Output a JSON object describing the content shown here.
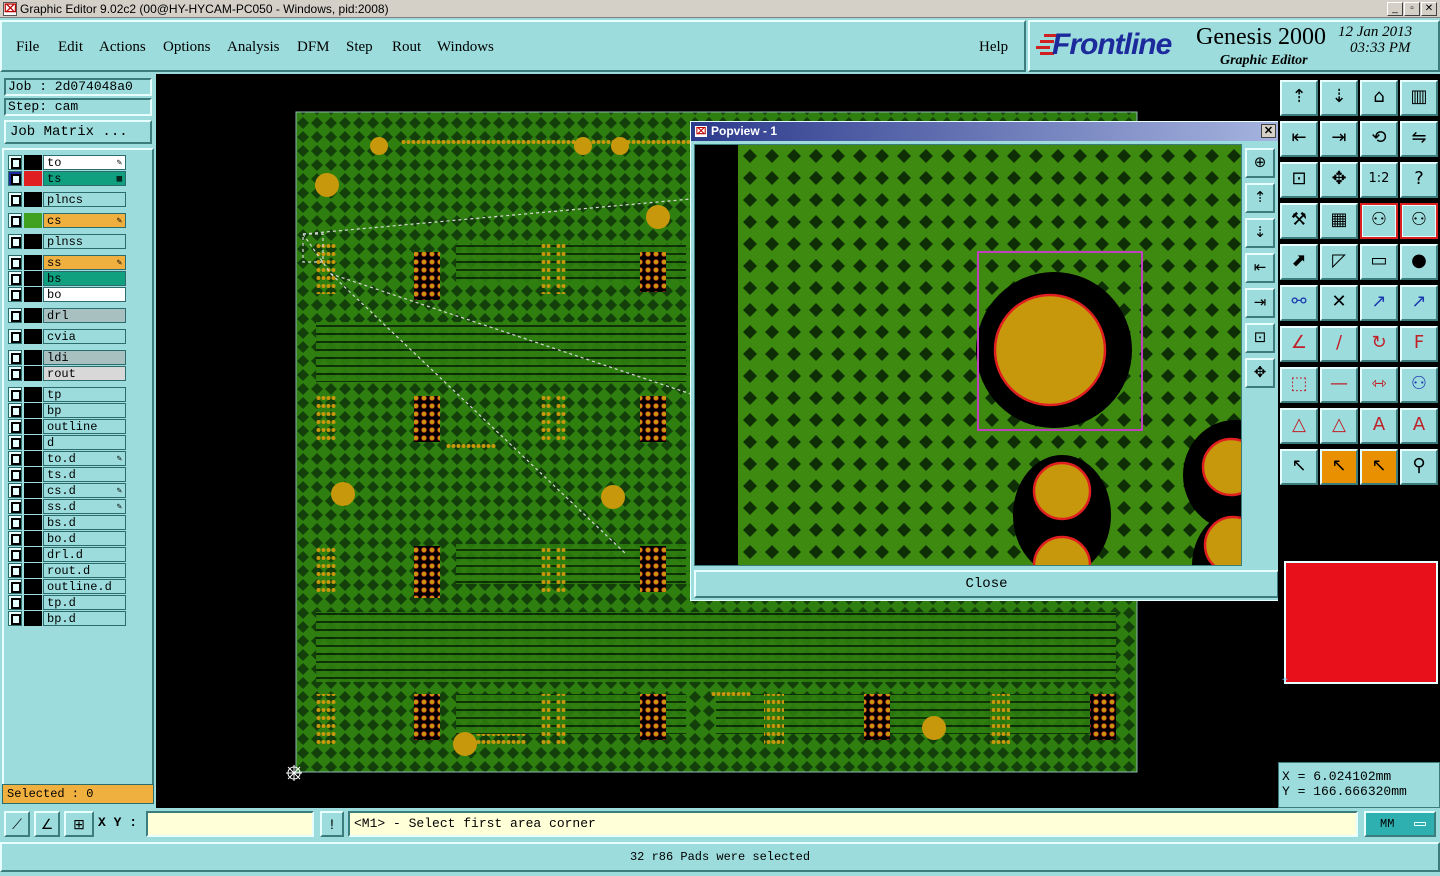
{
  "window": {
    "title": "Graphic Editor 9.02c2 (00@HY-HYCAM-PC050 - Windows, pid:2008)",
    "controls": {
      "minimize": "_",
      "maximize": "▫",
      "close": "✕"
    }
  },
  "menu": {
    "items": [
      "File",
      "Edit",
      "Actions",
      "Options",
      "Analysis",
      "DFM",
      "Step",
      "Rout",
      "Windows"
    ],
    "help": "Help"
  },
  "brand": {
    "logo": "Frontline",
    "product": "Genesis 2000",
    "subtitle": "Graphic Editor",
    "date": "12 Jan 2013",
    "time": "03:33 PM"
  },
  "job": {
    "job_label": "Job : 2d074048a0",
    "step_label": "Step: cam",
    "matrix_button": "Job Matrix ..."
  },
  "layers": [
    {
      "name": "to",
      "swatch": "#000000",
      "bg": "#ffffff",
      "flag": "✎"
    },
    {
      "name": "ts",
      "swatch": "#e02020",
      "bg": "#10a080",
      "flag": "▦",
      "work": true
    },
    {
      "name": "plncs",
      "swatch": "#000000",
      "bg": "#9cdcdc",
      "flag": ""
    },
    {
      "name": "cs",
      "swatch": "#40a020",
      "bg": "#f0b040",
      "flag": "✎"
    },
    {
      "name": "plnss",
      "swatch": "#000000",
      "bg": "#9cdcdc",
      "flag": ""
    },
    {
      "name": "ss",
      "swatch": "#000000",
      "bg": "#f0b040",
      "flag": "✎"
    },
    {
      "name": "bs",
      "swatch": "#000000",
      "bg": "#10a080",
      "flag": ""
    },
    {
      "name": "bo",
      "swatch": "#000000",
      "bg": "#ffffff",
      "flag": ""
    },
    {
      "name": "drl",
      "swatch": "#000000",
      "bg": "#a8c0c0",
      "flag": ""
    },
    {
      "name": "cvia",
      "swatch": "#000000",
      "bg": "#9cdcdc",
      "flag": ""
    },
    {
      "name": "ldi",
      "swatch": "#000000",
      "bg": "#a8c0c0",
      "flag": ""
    },
    {
      "name": "rout",
      "swatch": "#000000",
      "bg": "#d8d8d8",
      "flag": ""
    },
    {
      "name": "tp",
      "swatch": "#000000",
      "bg": "#9cdcdc",
      "flag": ""
    },
    {
      "name": "bp",
      "swatch": "#000000",
      "bg": "#9cdcdc",
      "flag": ""
    },
    {
      "name": "outline",
      "swatch": "#000000",
      "bg": "#9cdcdc",
      "flag": ""
    },
    {
      "name": "d",
      "swatch": "#000000",
      "bg": "#9cdcdc",
      "flag": ""
    },
    {
      "name": "to.d",
      "swatch": "#000000",
      "bg": "#9cdcdc",
      "flag": "✎"
    },
    {
      "name": "ts.d",
      "swatch": "#000000",
      "bg": "#9cdcdc",
      "flag": ""
    },
    {
      "name": "cs.d",
      "swatch": "#000000",
      "bg": "#9cdcdc",
      "flag": "✎"
    },
    {
      "name": "ss.d",
      "swatch": "#000000",
      "bg": "#9cdcdc",
      "flag": "✎"
    },
    {
      "name": "bs.d",
      "swatch": "#000000",
      "bg": "#9cdcdc",
      "flag": ""
    },
    {
      "name": "bo.d",
      "swatch": "#000000",
      "bg": "#9cdcdc",
      "flag": ""
    },
    {
      "name": "drl.d",
      "swatch": "#000000",
      "bg": "#9cdcdc",
      "flag": ""
    },
    {
      "name": "rout.d",
      "swatch": "#000000",
      "bg": "#9cdcdc",
      "flag": ""
    },
    {
      "name": "outline.d",
      "swatch": "#000000",
      "bg": "#9cdcdc",
      "flag": ""
    },
    {
      "name": "tp.d",
      "swatch": "#000000",
      "bg": "#9cdcdc",
      "flag": ""
    },
    {
      "name": "bp.d",
      "swatch": "#000000",
      "bg": "#9cdcdc",
      "flag": ""
    }
  ],
  "selected_label": "Selected : 0",
  "popview": {
    "title": "Popview - 1",
    "close_button": "Close"
  },
  "coords": {
    "x": "X  =   6.024102mm",
    "y": "Y  = 166.666320mm"
  },
  "command": {
    "xy_label": "X Y :",
    "xy_value": "",
    "prompt": "<M1> - Select first area corner",
    "units": "MM"
  },
  "status": "32 r86 Pads were selected",
  "colors": {
    "panel": "#9cdcdc",
    "board": "#2e7f0f",
    "pad": "#c8980c",
    "highlight_frame": "#c040c0",
    "selection_red": "#e02020"
  },
  "toolbar_icons": [
    "zoom-home-icon",
    "zoom-in-icon",
    "house-icon",
    "window-icon",
    "pan-left-icon",
    "pan-right-icon",
    "flip-icon",
    "mirror-icon",
    "fit-icon",
    "center-icon",
    "scale-1-2-icon",
    "help-icon",
    "measure-icon",
    "grid-icon",
    "snap-red-icon",
    "snap-red2-icon",
    "feature-arrow-icon",
    "rotate-icon",
    "ruler-icon",
    "dot-icon",
    "net-icon",
    "cross-icon",
    "move-icon",
    "copy-icon",
    "angle-icon",
    "line-icon",
    "arc-icon",
    "text-icon",
    "pad-icon",
    "minus-icon",
    "dimension-icon",
    "group-icon",
    "triangle-icon",
    "triangle2-icon",
    "tri-a-icon",
    "tri-a2-icon",
    "pointer-icon",
    "pointer-orange-icon",
    "pointer-orange2-icon",
    "route-icon"
  ],
  "popview_icons": [
    "pv-zoom-icon",
    "pv-up-icon",
    "pv-down-icon",
    "pv-left-icon",
    "pv-right-icon",
    "pv-fit-icon",
    "pv-center-icon"
  ]
}
